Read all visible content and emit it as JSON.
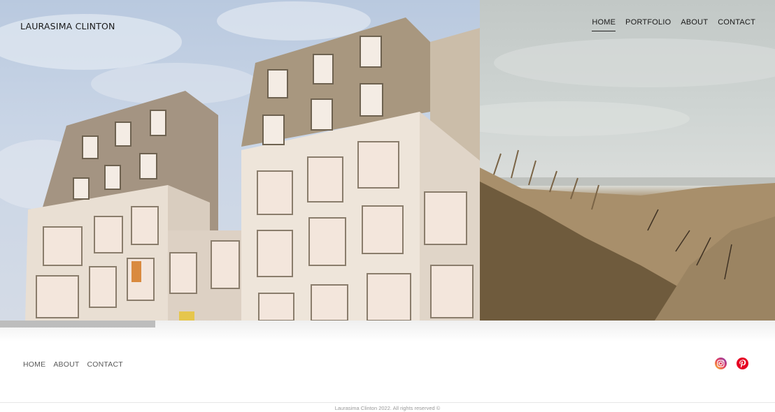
{
  "header": {
    "brand": "LAURASIMA CLINTON",
    "nav": [
      {
        "label": "HOME",
        "active": true
      },
      {
        "label": "PORTFOLIO",
        "active": false
      },
      {
        "label": "ABOUT",
        "active": false
      },
      {
        "label": "CONTACT",
        "active": false
      }
    ]
  },
  "hero": {
    "slides": [
      {
        "subject": "apartment building against blue sky"
      },
      {
        "subject": "sand dunes with grass and grey sky"
      }
    ],
    "slide_progress": 0.2
  },
  "footer": {
    "nav": [
      {
        "label": "HOME"
      },
      {
        "label": "ABOUT"
      },
      {
        "label": "CONTACT"
      }
    ],
    "social": [
      {
        "name": "instagram-icon",
        "color": "#d6249f"
      },
      {
        "name": "pinterest-icon",
        "color": "#e60023"
      }
    ],
    "copyright": "Laurasima Clinton 2022. All rights reserved ©"
  }
}
